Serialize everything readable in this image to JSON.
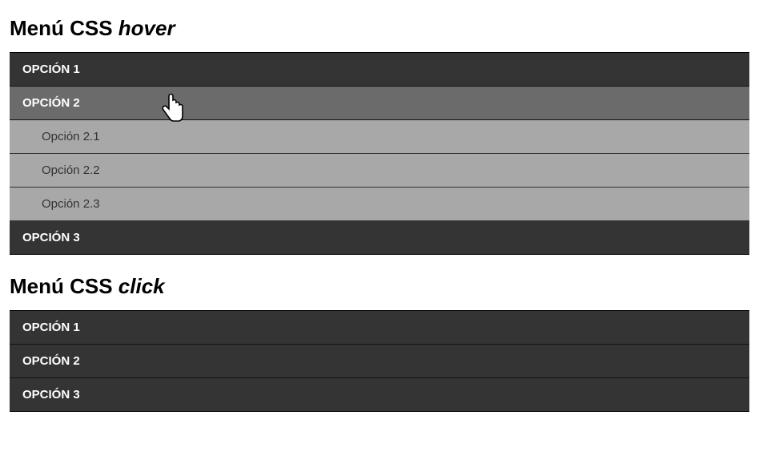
{
  "heading_hover": {
    "prefix": "Menú CSS ",
    "emphasis": "hover"
  },
  "heading_click": {
    "prefix": "Menú CSS ",
    "emphasis": "click"
  },
  "menu_hover": {
    "items": [
      {
        "label": "OPCIÓN 1",
        "hovered": false,
        "submenu": []
      },
      {
        "label": "OPCIÓN 2",
        "hovered": true,
        "submenu": [
          {
            "label": "Opción 2.1"
          },
          {
            "label": "Opción 2.2"
          },
          {
            "label": "Opción 2.3"
          }
        ]
      },
      {
        "label": "OPCIÓN 3",
        "hovered": false,
        "submenu": []
      }
    ]
  },
  "menu_click": {
    "items": [
      {
        "label": "OPCIÓN 1"
      },
      {
        "label": "OPCIÓN 2"
      },
      {
        "label": "OPCIÓN 3"
      }
    ]
  },
  "cursor_icon_name": "pointer-hand"
}
